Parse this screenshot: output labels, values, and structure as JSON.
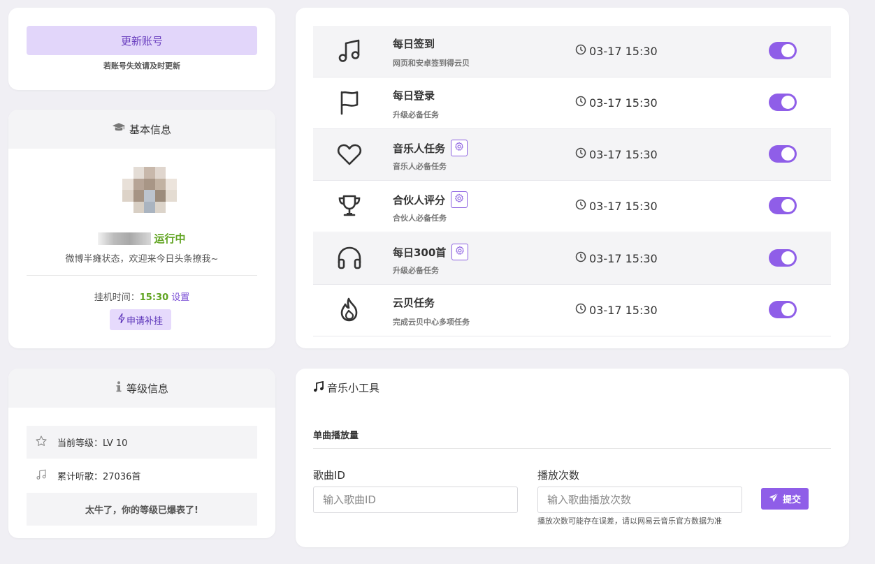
{
  "account": {
    "update_label": "更新账号",
    "hint": "若账号失效请及时更新"
  },
  "basic": {
    "title": "基本信息",
    "title_icon": "graduation-cap-icon",
    "status": "运行中",
    "motto": "微博半瘫状态，欢迎来今日头条撩我~",
    "hang_label": "挂机时间：",
    "hang_time": "15:30",
    "hang_set": "设置",
    "supplement_label": "申请补挂",
    "supplement_icon": "bolt-icon"
  },
  "level": {
    "title": "等级信息",
    "title_icon": "info-icon",
    "current_level": "当前等级：LV 10",
    "listened": "累计听歌：27036首",
    "boast": "太牛了，你的等级已爆表了!"
  },
  "tasks": [
    {
      "icon": "music-note-icon",
      "title": "每日签到",
      "desc": "网页和安卓签到得云贝",
      "time": "03-17 15:30",
      "enabled": true,
      "has_settings": false
    },
    {
      "icon": "flag-icon",
      "title": "每日登录",
      "desc": "升级必备任务",
      "time": "03-17 15:30",
      "enabled": true,
      "has_settings": false
    },
    {
      "icon": "heart-icon",
      "title": "音乐人任务",
      "desc": "音乐人必备任务",
      "time": "03-17 15:30",
      "enabled": true,
      "has_settings": true
    },
    {
      "icon": "trophy-icon",
      "title": "合伙人评分",
      "desc": "合伙人必备任务",
      "time": "03-17 15:30",
      "enabled": true,
      "has_settings": true
    },
    {
      "icon": "headphones-icon",
      "title": "每日300首",
      "desc": "升级必备任务",
      "time": "03-17 15:30",
      "enabled": true,
      "has_settings": true
    },
    {
      "icon": "fire-icon",
      "title": "云贝任务",
      "desc": "完成云贝中心多项任务",
      "time": "03-17 15:30",
      "enabled": true,
      "has_settings": false
    }
  ],
  "tools": {
    "title": "音乐小工具",
    "section": "单曲播放量",
    "song_id_label": "歌曲ID",
    "song_id_placeholder": "输入歌曲ID",
    "play_count_label": "播放次数",
    "play_count_placeholder": "输入歌曲播放次数",
    "note": "播放次数可能存在误差，请以网易云音乐官方数据为准",
    "submit_label": "提交",
    "submit_icon": "paper-plane-icon"
  },
  "colors": {
    "accent": "#8f5ee8",
    "accent_light": "#e2d6fa",
    "status_green": "#5fa31f",
    "page_bg": "#f0eff4"
  }
}
